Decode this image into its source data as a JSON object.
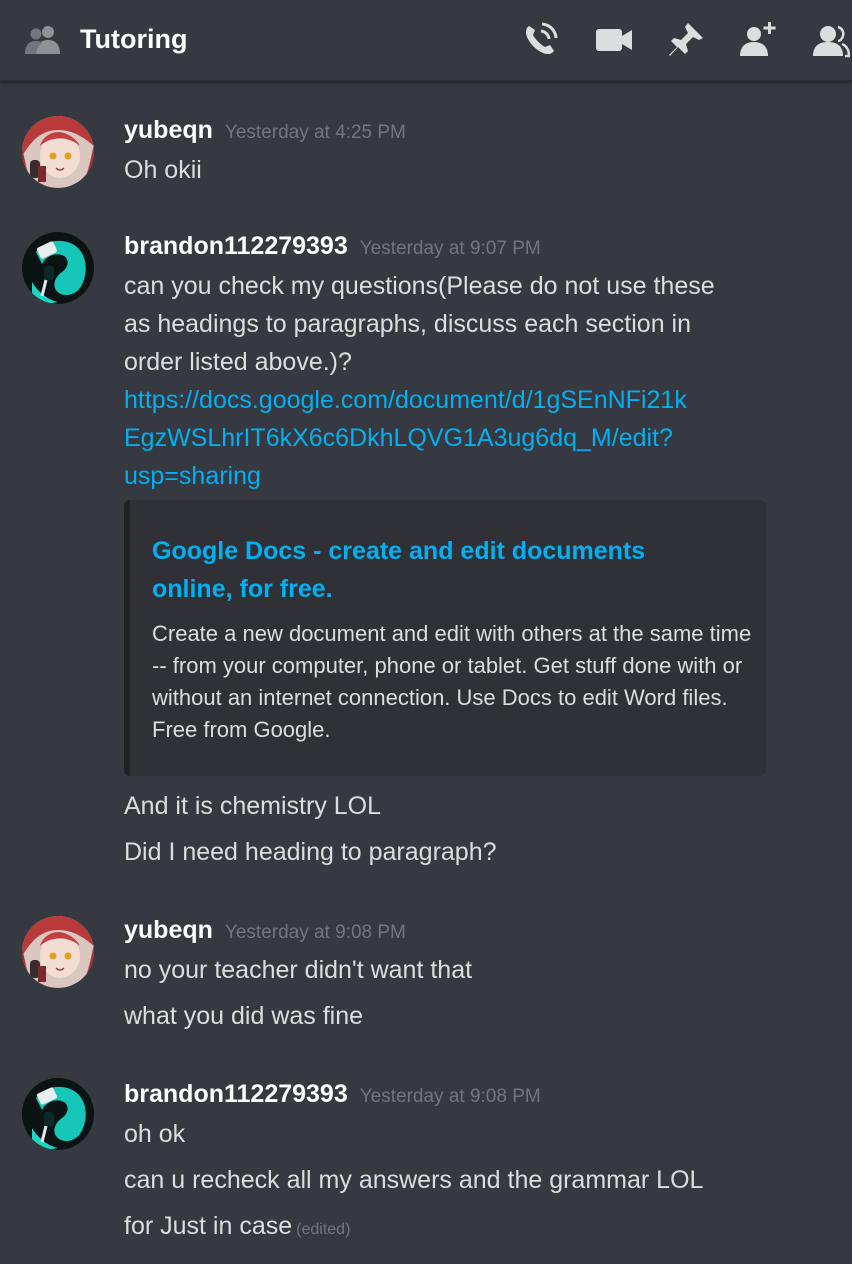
{
  "header": {
    "title": "Tutoring",
    "icons": [
      "group-icon",
      "start-voice-call-icon",
      "start-video-call-icon",
      "pinned-messages-icon",
      "add-friends-to-dm-icon",
      "member-list-icon"
    ]
  },
  "colors": {
    "background": "#36393f",
    "link": "#00b0f4",
    "timestamp": "#72767d",
    "text": "#dcddde",
    "embed_bg": "#2f3136"
  },
  "messages": [
    {
      "author": "yubeqn",
      "timestamp": "Yesterday at 4:25 PM",
      "lines": [
        "Oh okii"
      ]
    },
    {
      "author": "brandon112279393",
      "timestamp": "Yesterday at 9:07 PM",
      "lines": [
        "can you check my questions(Please do not use these",
        "as headings to paragraphs, discuss each section in",
        "order listed above.)?"
      ],
      "link_lines": [
        "https://docs.google.com/document/d/1gSEnNFi21k",
        "EgzWSLhrIT6kX6c6DkhLQVG1A3ug6dq_M/edit?",
        "usp=sharing"
      ],
      "embed": {
        "title": "Google Docs - create and edit documents online, for free.",
        "description": "Create a new document and edit with others at the same time -- from your computer, phone or tablet. Get stuff done with or without an internet connection. Use Docs to edit Word files. Free from Google."
      },
      "followups": [
        "And it is chemistry LOL",
        "Did I need heading to paragraph?"
      ]
    },
    {
      "author": "yubeqn",
      "timestamp": "Yesterday at 9:08 PM",
      "lines": [
        "no your teacher didn't want that",
        "what you did was fine"
      ]
    },
    {
      "author": "brandon112279393",
      "timestamp": "Yesterday at 9:08 PM",
      "lines": [
        "oh ok",
        "can u recheck all my answers and the grammar LOL",
        "for Just in case"
      ],
      "edited_label": "(edited)"
    }
  ]
}
